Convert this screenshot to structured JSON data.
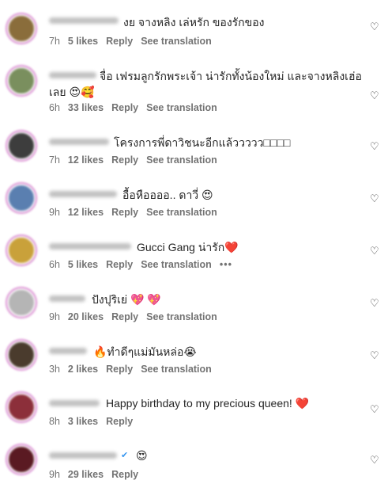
{
  "comments": [
    {
      "text": "งย จางหลิง เล่หรัก ของรักของ",
      "time": "7h",
      "likes": "5 likes",
      "reply": "Reply",
      "translate": "See translation",
      "avatar_color": "#8a6d3b"
    },
    {
      "text_line1": "จื่อ เฟรมลูกรักพระเจ้า น่ารักทั้งน้องใหม่ และจางหลิงเฮ่อ",
      "text_line2": "เลย 😍🥰",
      "time": "6h",
      "likes": "33 likes",
      "reply": "Reply",
      "translate": "See translation",
      "avatar_color": "#7a8f5e"
    },
    {
      "text": "โครงการพี่ดาวิชนะอีกแล้ววววว□□□□",
      "time": "7h",
      "likes": "12 likes",
      "reply": "Reply",
      "translate": "See translation",
      "avatar_color": "#3d3d3d"
    },
    {
      "text": "อื้อหืออออ.. ดาวี่ 😍",
      "time": "9h",
      "likes": "12 likes",
      "reply": "Reply",
      "translate": "See translation",
      "avatar_color": "#5a7fb0"
    },
    {
      "text": "Gucci Gang น่ารัก❤️",
      "time": "6h",
      "likes": "5 likes",
      "reply": "Reply",
      "translate": "See translation",
      "more": "•••",
      "avatar_color": "#c9a13a"
    },
    {
      "text": "ปังปุริเย่ 💖 💖",
      "time": "9h",
      "likes": "20 likes",
      "reply": "Reply",
      "translate": "See translation",
      "avatar_color": "#b5b5b5"
    },
    {
      "text": "🔥ทำดีๆแม่มันหล่อ😭",
      "time": "3h",
      "likes": "2 likes",
      "reply": "Reply",
      "translate": "See translation",
      "avatar_color": "#4a3b2d"
    },
    {
      "text": "Happy birthday to my precious queen! ❤️",
      "time": "8h",
      "likes": "3 likes",
      "reply": "Reply",
      "avatar_color": "#8c2f3a"
    },
    {
      "text": "😍",
      "time": "9h",
      "likes": "29 likes",
      "reply": "Reply",
      "verified": "✔",
      "avatar_color": "#5a1a22"
    }
  ],
  "like_icon": "heart-outline-icon"
}
